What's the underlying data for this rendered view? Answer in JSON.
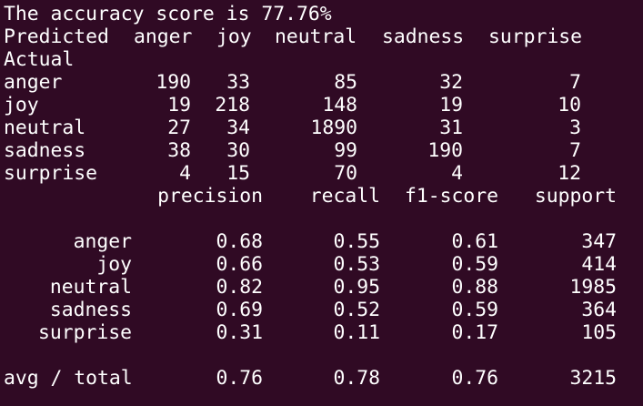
{
  "terminal": {
    "background": "#300a24",
    "foreground": "#ffffff",
    "accuracy_line": "The accuracy score is 77.76%",
    "confusion_matrix": {
      "header_label": "Predicted",
      "actual_label": "Actual",
      "columns": [
        "anger",
        "joy",
        "neutral",
        "sadness",
        "surprise"
      ],
      "rows": [
        {
          "label": "anger",
          "values": [
            "190",
            "33",
            "85",
            "32",
            "7"
          ]
        },
        {
          "label": "joy",
          "values": [
            "19",
            "218",
            "148",
            "19",
            "10"
          ]
        },
        {
          "label": "neutral",
          "values": [
            "27",
            "34",
            "1890",
            "31",
            "3"
          ]
        },
        {
          "label": "sadness",
          "values": [
            "38",
            "30",
            "99",
            "190",
            "7"
          ]
        },
        {
          "label": "surprise",
          "values": [
            "4",
            "15",
            "70",
            "4",
            "12"
          ]
        }
      ]
    },
    "classification_report": {
      "headers": [
        "precision",
        "recall",
        "f1-score",
        "support"
      ],
      "rows": [
        {
          "label": "anger",
          "values": [
            "0.68",
            "0.55",
            "0.61",
            "347"
          ]
        },
        {
          "label": "joy",
          "values": [
            "0.66",
            "0.53",
            "0.59",
            "414"
          ]
        },
        {
          "label": "neutral",
          "values": [
            "0.82",
            "0.95",
            "0.88",
            "1985"
          ]
        },
        {
          "label": "sadness",
          "values": [
            "0.69",
            "0.52",
            "0.59",
            "364"
          ]
        },
        {
          "label": "surprise",
          "values": [
            "0.31",
            "0.11",
            "0.17",
            "105"
          ]
        }
      ],
      "total": {
        "label": "avg / total",
        "values": [
          "0.76",
          "0.78",
          "0.76",
          "3215"
        ]
      }
    }
  }
}
